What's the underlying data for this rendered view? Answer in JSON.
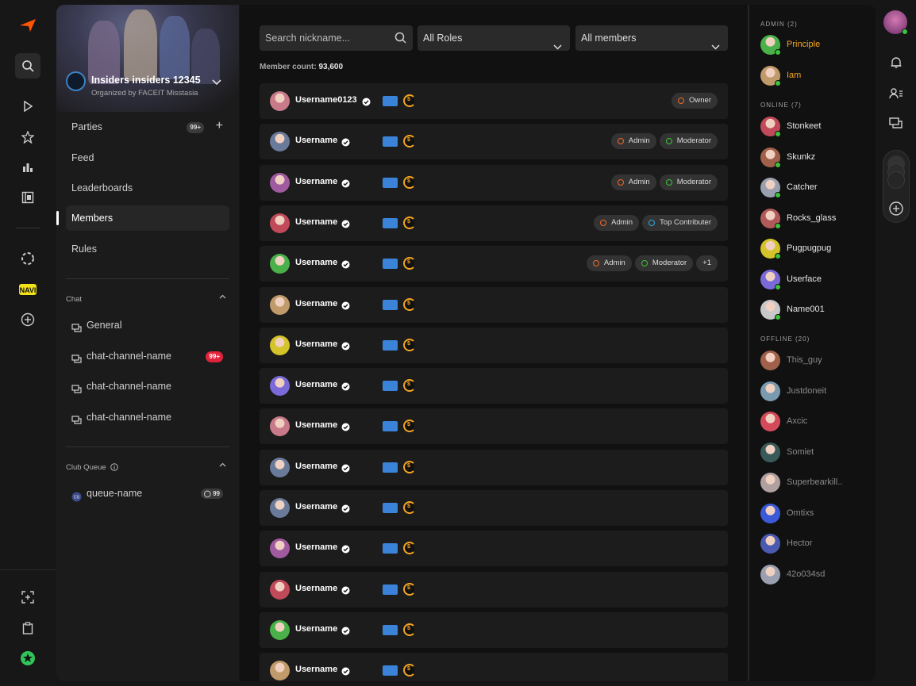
{
  "left_rail": {
    "icons": [
      "faceit-logo-icon",
      "search-icon",
      "play-icon",
      "star-icon",
      "stats-icon",
      "film-icon",
      "dotted-circle-icon",
      "navi-logo-icon",
      "add-circle-icon",
      "expand-icon",
      "clipboard-icon",
      "star-badge-icon"
    ]
  },
  "club": {
    "name": "Insiders insiders 12345",
    "organizer": "Organized by FACEIT Misstasia"
  },
  "nav": {
    "parties": "Parties",
    "parties_badge": "99+",
    "feed": "Feed",
    "leaderboards": "Leaderboards",
    "members": "Members",
    "rules": "Rules"
  },
  "chat": {
    "title": "Chat",
    "channels": [
      {
        "name": "General",
        "badge": ""
      },
      {
        "name": "chat-channel-name",
        "badge": "99+"
      },
      {
        "name": "chat-channel-name",
        "badge": ""
      },
      {
        "name": "chat-channel-name",
        "badge": ""
      }
    ]
  },
  "queue": {
    "title": "Club Queue",
    "name": "queue-name",
    "count": "99"
  },
  "filters": {
    "search_placeholder": "Search nickname...",
    "roles": "All Roles",
    "members": "All members"
  },
  "member_count": {
    "label": "Member count:",
    "value": "93,600"
  },
  "members": [
    {
      "name": "Username0123",
      "avatar": "#c87a8a",
      "roles": [
        {
          "label": "Owner",
          "color": "#f06a2a"
        }
      ]
    },
    {
      "name": "Username",
      "avatar": "#6a7a9a",
      "roles": [
        {
          "label": "Admin",
          "color": "#f06a2a"
        },
        {
          "label": "Moderator",
          "color": "#3ac43a"
        }
      ]
    },
    {
      "name": "Username",
      "avatar": "#a05aa0",
      "roles": [
        {
          "label": "Admin",
          "color": "#f06a2a"
        },
        {
          "label": "Moderator",
          "color": "#3ac43a"
        }
      ]
    },
    {
      "name": "Username",
      "avatar": "#c04a5a",
      "roles": [
        {
          "label": "Admin",
          "color": "#f06a2a"
        },
        {
          "label": "Top Contributer",
          "color": "#2aa8e0"
        }
      ]
    },
    {
      "name": "Username",
      "avatar": "#4ab04a",
      "roles": [
        {
          "label": "Admin",
          "color": "#f06a2a"
        },
        {
          "label": "Moderator",
          "color": "#3ac43a"
        }
      ],
      "more": "+1"
    },
    {
      "name": "Username",
      "avatar": "#c09a6a",
      "roles": []
    },
    {
      "name": "Username",
      "avatar": "#d4c42a",
      "roles": []
    },
    {
      "name": "Username",
      "avatar": "#7a6ad8",
      "roles": []
    },
    {
      "name": "Username",
      "avatar": "#c87a8a",
      "roles": []
    },
    {
      "name": "Username",
      "avatar": "#6a7a9a",
      "roles": []
    },
    {
      "name": "Username",
      "avatar": "#6a7a9a",
      "roles": []
    },
    {
      "name": "Username",
      "avatar": "#a05aa0",
      "roles": []
    },
    {
      "name": "Username",
      "avatar": "#c04a5a",
      "roles": []
    },
    {
      "name": "Username",
      "avatar": "#4ab04a",
      "roles": []
    },
    {
      "name": "Username",
      "avatar": "#c09a6a",
      "roles": []
    }
  ],
  "sidebar": {
    "admin_title": "ADMIN (2)",
    "admins": [
      {
        "name": "Principle",
        "avatar": "#4ab04a"
      },
      {
        "name": "Iam",
        "avatar": "#c09a6a"
      }
    ],
    "online_title": "ONLINE (7)",
    "online": [
      {
        "name": "Stonkeet",
        "avatar": "#c04a5a"
      },
      {
        "name": "Skunkz",
        "avatar": "#a0604a"
      },
      {
        "name": "Catcher",
        "avatar": "#9aa0b0"
      },
      {
        "name": "Rocks_glass",
        "avatar": "#b05a5a"
      },
      {
        "name": "Pugpugpug",
        "avatar": "#d4c42a"
      },
      {
        "name": "Userface",
        "avatar": "#7a6ad8"
      },
      {
        "name": "Name001",
        "avatar": "#c8c8c8"
      }
    ],
    "offline_title": "OFFLINE (20)",
    "offline": [
      {
        "name": "This_guy",
        "avatar": "#a0604a"
      },
      {
        "name": "Justdoneit",
        "avatar": "#7a9ab0"
      },
      {
        "name": "Axcic",
        "avatar": "#d44a5a"
      },
      {
        "name": "Somiet",
        "avatar": "#3a5a5a"
      },
      {
        "name": "Superbearkill..",
        "avatar": "#b0a0a0"
      },
      {
        "name": "Omtixs",
        "avatar": "#3a5ad8"
      },
      {
        "name": "Hector",
        "avatar": "#4a5ab0"
      },
      {
        "name": "42o034sd",
        "avatar": "#9aa0b0"
      }
    ]
  },
  "colors": {
    "accent": "#ff5500",
    "admin_name": "#f6a623",
    "online_dot": "#3ac43a",
    "notification": "#e0223a"
  }
}
